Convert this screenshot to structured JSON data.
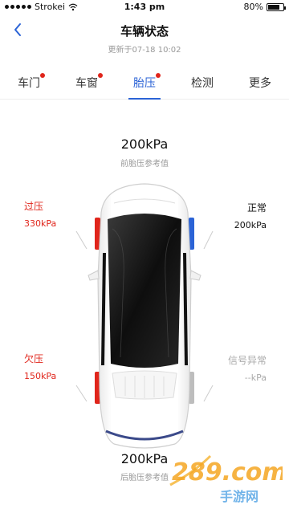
{
  "status_bar": {
    "carrier": "Strokei",
    "time": "1:43 pm",
    "battery": "80%",
    "battery_level": 0.8
  },
  "header": {
    "title": "车辆状态",
    "updated": "更新于07-18 10:02"
  },
  "tabs": [
    {
      "label": "车门",
      "badge": true,
      "active": false
    },
    {
      "label": "车窗",
      "badge": true,
      "active": false
    },
    {
      "label": "胎压",
      "badge": true,
      "active": true
    },
    {
      "label": "检测",
      "badge": false,
      "active": false
    },
    {
      "label": "更多",
      "badge": false,
      "active": false
    }
  ],
  "front": {
    "value": "200kPa",
    "label": "前胎压参考值"
  },
  "rear": {
    "value": "200kPa",
    "label": "后胎压参考值"
  },
  "tires": {
    "front_left": {
      "status": "过压",
      "value": "330kPa"
    },
    "front_right": {
      "status": "正常",
      "value": "200kPa"
    },
    "rear_left": {
      "status": "欠压",
      "value": "150kPa"
    },
    "rear_right": {
      "status": "信号异常",
      "value": "--kPa"
    }
  },
  "watermark": {
    "brand": "289.com",
    "sub": "手游网"
  },
  "colors": {
    "accent": "#2b63d6",
    "alert": "#e0251b",
    "muted": "#999999"
  }
}
